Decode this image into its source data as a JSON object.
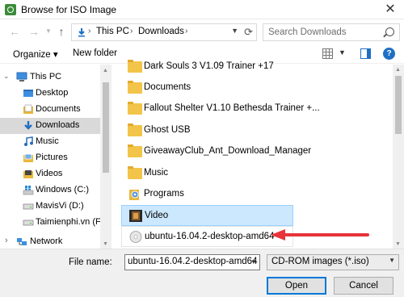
{
  "window": {
    "title": "Browse for ISO Image",
    "close_glyph": "✕"
  },
  "navigation": {
    "back_glyph": "←",
    "forward_glyph": "→",
    "up_glyph": "↑",
    "path": [
      "This PC",
      "Downloads"
    ],
    "chevron_glyph": "›",
    "search_placeholder": "Search Downloads"
  },
  "toolbar": {
    "organize_label": "Organize ▾",
    "new_folder_label": "New folder",
    "view_dropdown_glyph": "▼"
  },
  "sidebar": {
    "items": [
      {
        "label": "This PC",
        "icon": "computer-icon",
        "indent": 0,
        "expander": "⌄",
        "selected": false
      },
      {
        "label": "Desktop",
        "icon": "desktop-folder-icon",
        "indent": 1,
        "expander": "",
        "selected": false
      },
      {
        "label": "Documents",
        "icon": "documents-folder-icon",
        "indent": 1,
        "expander": "",
        "selected": false
      },
      {
        "label": "Downloads",
        "icon": "downloads-icon",
        "indent": 1,
        "expander": "",
        "selected": true
      },
      {
        "label": "Music",
        "icon": "music-icon",
        "indent": 1,
        "expander": "",
        "selected": false
      },
      {
        "label": "Pictures",
        "icon": "pictures-folder-icon",
        "indent": 1,
        "expander": "",
        "selected": false
      },
      {
        "label": "Videos",
        "icon": "videos-folder-icon",
        "indent": 1,
        "expander": "",
        "selected": false
      },
      {
        "label": "Windows (C:)",
        "icon": "windows-drive-icon",
        "indent": 1,
        "expander": "",
        "selected": false
      },
      {
        "label": "MavisVi (D:)",
        "icon": "drive-icon",
        "indent": 1,
        "expander": "",
        "selected": false
      },
      {
        "label": "Taimienphi.vn (F:)",
        "icon": "drive-icon",
        "indent": 1,
        "expander": "",
        "selected": false
      },
      {
        "label": "Network",
        "icon": "network-icon",
        "indent": 0,
        "expander": "›",
        "selected": false
      }
    ]
  },
  "files": [
    {
      "name": "Dark Souls 3 V1.09 Trainer +17",
      "icon": "folder-icon",
      "state": "normal"
    },
    {
      "name": "Documents",
      "icon": "folder-icon",
      "state": "normal"
    },
    {
      "name": "Fallout Shelter V1.10 Bethesda Trainer +...",
      "icon": "folder-icon",
      "state": "normal"
    },
    {
      "name": "Ghost USB",
      "icon": "folder-icon",
      "state": "normal"
    },
    {
      "name": "GiveawayClub_Ant_Download_Manager",
      "icon": "folder-icon",
      "state": "normal"
    },
    {
      "name": "Music",
      "icon": "folder-icon",
      "state": "normal"
    },
    {
      "name": "Programs",
      "icon": "programs-folder-icon",
      "state": "normal"
    },
    {
      "name": "Video",
      "icon": "video-folder-icon",
      "state": "selected"
    },
    {
      "name": "ubuntu-16.04.2-desktop-amd64",
      "icon": "disc-image-icon",
      "state": "hovered"
    }
  ],
  "footer": {
    "file_name_label": "File name:",
    "file_name_value": "ubuntu-16.04.2-desktop-amd64",
    "file_type_value": "CD-ROM images (*.iso)",
    "dropdown_glyph": "▼",
    "open_label": "Open",
    "cancel_label": "Cancel"
  },
  "colors": {
    "selection_bg": "#cce8ff",
    "nav_selected_bg": "#d9d9d9",
    "annotation_arrow": "#e8333a",
    "folder_yellow": "#f2c449",
    "accent_blue": "#0078d7"
  }
}
